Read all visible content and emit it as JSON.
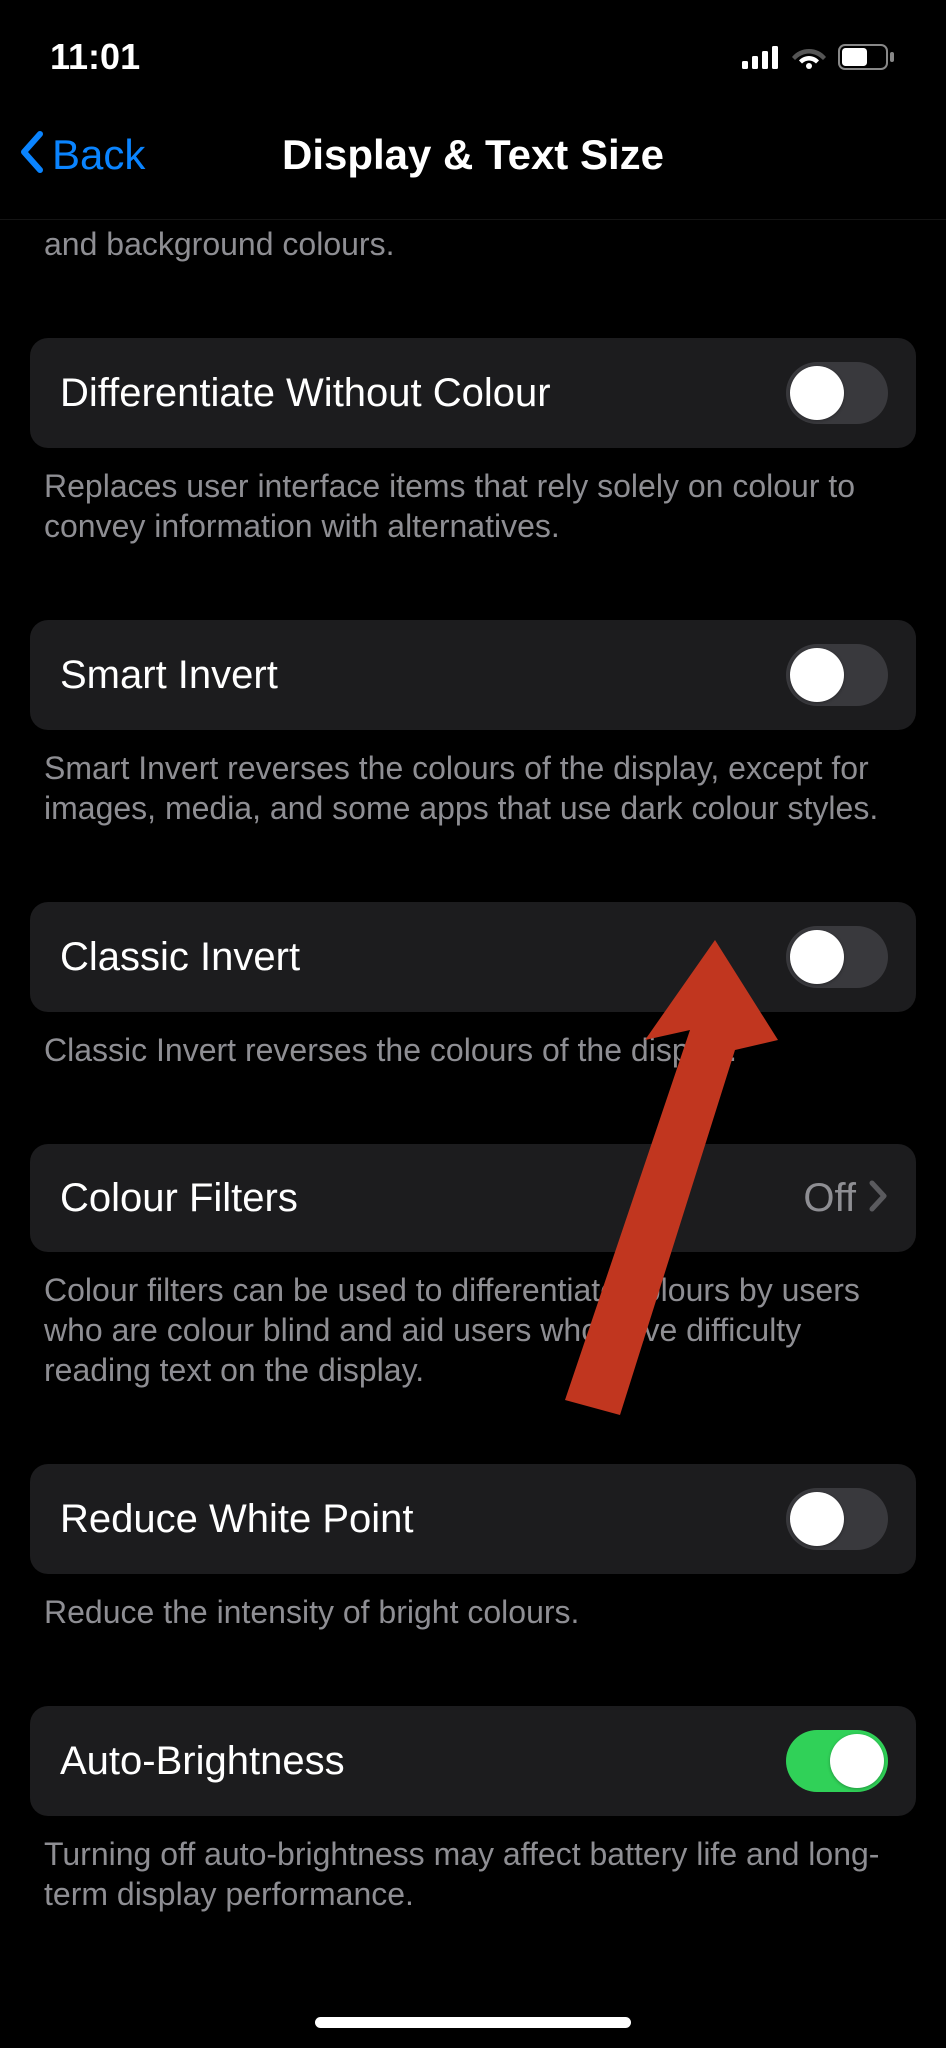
{
  "status": {
    "time": "11:01"
  },
  "nav": {
    "back_label": "Back",
    "title": "Display & Text Size"
  },
  "truncated_footer": "and background colours.",
  "settings": [
    {
      "label": "Differentiate Without Colour",
      "type": "switch",
      "on": false,
      "footer": "Replaces user interface items that rely solely on colour to convey information with alternatives."
    },
    {
      "label": "Smart Invert",
      "type": "switch",
      "on": false,
      "footer": "Smart Invert reverses the colours of the display, except for images, media, and some apps that use dark colour styles."
    },
    {
      "label": "Classic Invert",
      "type": "switch",
      "on": false,
      "footer": "Classic Invert reverses the colours of the display."
    },
    {
      "label": "Colour Filters",
      "type": "link",
      "value": "Off",
      "footer": "Colour filters can be used to differentiate colours by users who are colour blind and aid users who have difficulty reading text on the display."
    },
    {
      "label": "Reduce White Point",
      "type": "switch",
      "on": false,
      "footer": "Reduce the intensity of bright colours."
    },
    {
      "label": "Auto-Brightness",
      "type": "switch",
      "on": true,
      "footer": "Turning off auto-brightness may affect battery life and long-term display performance."
    }
  ],
  "annotation": {
    "type": "arrow",
    "color": "#c0392b",
    "points_to": "classic-invert-switch"
  }
}
